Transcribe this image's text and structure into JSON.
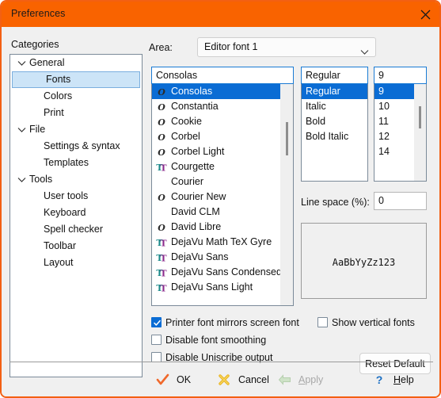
{
  "window": {
    "title": "Preferences",
    "titlebar_color": "#f96300",
    "border_color": "#f36013",
    "close_icon": "close-icon"
  },
  "categories": {
    "label": "Categories",
    "items": [
      {
        "label": "General",
        "level": "group",
        "expanded": true,
        "selected": false
      },
      {
        "label": "Fonts",
        "level": "child",
        "expanded": false,
        "selected": true
      },
      {
        "label": "Colors",
        "level": "child",
        "expanded": false,
        "selected": false
      },
      {
        "label": "Print",
        "level": "child",
        "expanded": false,
        "selected": false
      },
      {
        "label": "File",
        "level": "group",
        "expanded": true,
        "selected": false
      },
      {
        "label": "Settings & syntax",
        "level": "child",
        "expanded": false,
        "selected": false
      },
      {
        "label": "Templates",
        "level": "child",
        "expanded": false,
        "selected": false
      },
      {
        "label": "Tools",
        "level": "group",
        "expanded": true,
        "selected": false
      },
      {
        "label": "User tools",
        "level": "child",
        "expanded": false,
        "selected": false
      },
      {
        "label": "Keyboard",
        "level": "child",
        "expanded": false,
        "selected": false
      },
      {
        "label": "Spell checker",
        "level": "child",
        "expanded": false,
        "selected": false
      },
      {
        "label": "Toolbar",
        "level": "child",
        "expanded": false,
        "selected": false
      },
      {
        "label": "Layout",
        "level": "child",
        "expanded": false,
        "selected": false
      }
    ]
  },
  "area": {
    "label": "Area:",
    "value": "Editor font 1",
    "chevron_icon": "chevron-down-icon"
  },
  "font_name": {
    "value": "Consolas",
    "items": [
      {
        "name": "Consolas",
        "icon": "opentype-icon",
        "selected": true
      },
      {
        "name": "Constantia",
        "icon": "opentype-icon",
        "selected": false
      },
      {
        "name": "Cookie",
        "icon": "opentype-icon",
        "selected": false
      },
      {
        "name": "Corbel",
        "icon": "opentype-icon",
        "selected": false
      },
      {
        "name": "Corbel Light",
        "icon": "opentype-icon",
        "selected": false
      },
      {
        "name": "Courgette",
        "icon": "truetype-icon",
        "selected": false
      },
      {
        "name": "Courier",
        "icon": "none",
        "selected": false
      },
      {
        "name": "Courier New",
        "icon": "opentype-icon",
        "selected": false
      },
      {
        "name": "David CLM",
        "icon": "none",
        "selected": false
      },
      {
        "name": "David Libre",
        "icon": "opentype-icon",
        "selected": false
      },
      {
        "name": "DejaVu Math TeX Gyre",
        "icon": "truetype-icon",
        "selected": false
      },
      {
        "name": "DejaVu Sans",
        "icon": "truetype-icon",
        "selected": false
      },
      {
        "name": "DejaVu Sans Condensed",
        "icon": "truetype-icon",
        "selected": false
      },
      {
        "name": "DejaVu Sans Light",
        "icon": "truetype-icon",
        "selected": false
      }
    ]
  },
  "font_style": {
    "value": "Regular",
    "items": [
      {
        "name": "Regular",
        "selected": true
      },
      {
        "name": "Italic",
        "selected": false
      },
      {
        "name": "Bold",
        "selected": false
      },
      {
        "name": "Bold Italic",
        "selected": false
      }
    ]
  },
  "font_size": {
    "value": "9",
    "items": [
      {
        "name": "9",
        "selected": true
      },
      {
        "name": "10",
        "selected": false
      },
      {
        "name": "11",
        "selected": false
      },
      {
        "name": "12",
        "selected": false
      },
      {
        "name": "14",
        "selected": false
      }
    ]
  },
  "line_space": {
    "label": "Line space (%):",
    "value": "0"
  },
  "preview": {
    "sample_text": "AaBbYyZz123"
  },
  "options": [
    {
      "label": "Printer font mirrors screen font",
      "checked": true
    },
    {
      "label": "Show vertical fonts",
      "checked": false
    },
    {
      "label": "Disable font smoothing",
      "checked": false
    },
    {
      "label": "Disable Uniscribe output",
      "checked": false
    }
  ],
  "reset_button": {
    "label": "Reset Default"
  },
  "buttons": [
    {
      "label": "OK",
      "icon": "checkmark-icon",
      "disabled": false
    },
    {
      "label": "Cancel",
      "icon": "cross-icon",
      "disabled": false
    },
    {
      "label": "Apply",
      "icon": "left-arrow-icon",
      "disabled": true
    },
    {
      "label": "Help",
      "icon": "question-mark-icon",
      "disabled": false
    }
  ]
}
